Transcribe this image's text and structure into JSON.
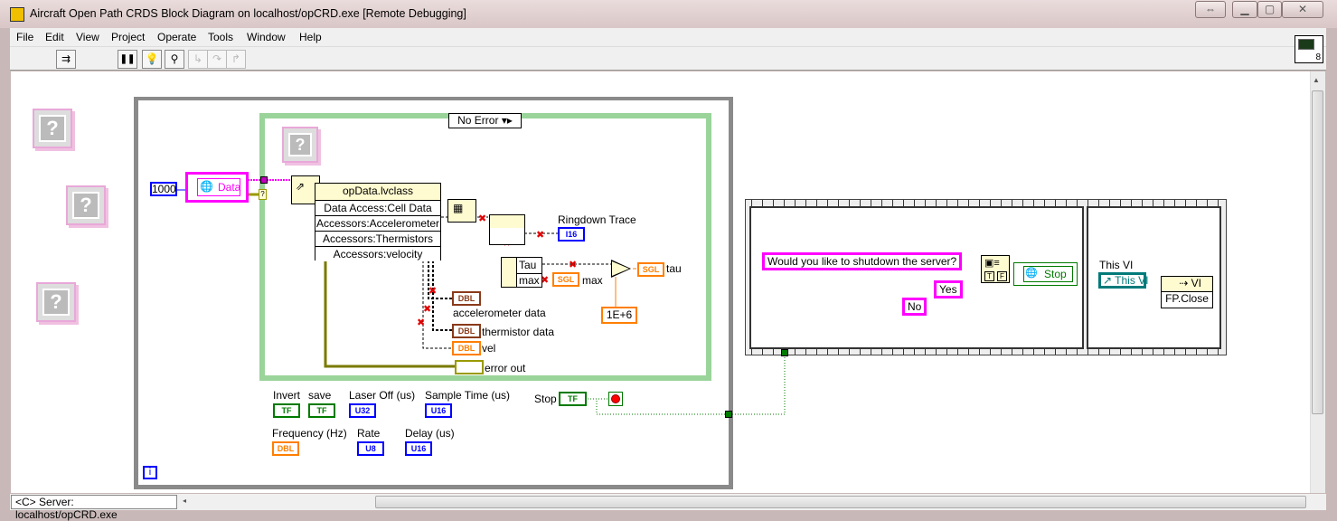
{
  "window": {
    "title": "Aircraft Open Path CRDS Block Diagram on localhost/opCRD.exe [Remote Debugging]",
    "controls": {
      "swap": "⇔",
      "minimize": "▁",
      "maximize": "▢",
      "close": "✕"
    }
  },
  "menu": [
    "File",
    "Edit",
    "View",
    "Project",
    "Operate",
    "Tools",
    "Window",
    "Help"
  ],
  "toolbar": {
    "buttons": [
      {
        "icon": "abort-remote-icon",
        "glyph": "⇉"
      },
      {
        "icon": "pause-icon",
        "glyph": "❚❚"
      },
      {
        "icon": "highlight-execution-bulb-icon",
        "glyph": "💡"
      },
      {
        "icon": "retain-wire-values-icon",
        "glyph": "⚲"
      },
      {
        "icon": "step-into-icon",
        "glyph": "↳"
      },
      {
        "icon": "step-over-icon",
        "glyph": "↷"
      },
      {
        "icon": "step-out-icon",
        "glyph": "↱"
      }
    ],
    "vi_icon_number": "8"
  },
  "diagram": {
    "timeout_const": "1000",
    "network_var": "Data",
    "case_selector": "No Error",
    "unbundle": {
      "class": "opData.lvclass",
      "items": [
        "Data Access:Cell Data",
        "Accessors:Accelerometer",
        "Accessors:Thermistors",
        "Accessors:velocity"
      ]
    },
    "indicators": {
      "ringdown": {
        "label": "Ringdown Trace",
        "type": "I16"
      },
      "tau": {
        "label": "tau",
        "type": "SGL"
      },
      "max": {
        "label": "max",
        "type": "SGL"
      },
      "accel": {
        "label": "accelerometer data",
        "type": "DBL"
      },
      "therm": {
        "label": "thermistor data",
        "type": "DBL"
      },
      "vel": {
        "label": "vel",
        "type": "DBL"
      },
      "error": {
        "label": "error out"
      }
    },
    "unbundle_tau": [
      "Tau",
      "max"
    ],
    "multiplier_const": "1E+6",
    "controls": [
      {
        "label": "Invert",
        "type": "TF"
      },
      {
        "label": "save",
        "type": "TF"
      },
      {
        "label": "Laser Off (us)",
        "type": "U32"
      },
      {
        "label": "Sample Time (us)",
        "type": "U16"
      },
      {
        "label": "Frequency (Hz)",
        "type": "DBL"
      },
      {
        "label": "Rate",
        "type": "U8"
      },
      {
        "label": "Delay (us)",
        "type": "U16"
      }
    ],
    "stop": {
      "label": "Stop",
      "type": "TF"
    },
    "iteration": "i",
    "dialog": {
      "message": "Would you like to shutdown the server?",
      "yes": "Yes",
      "no": "No",
      "t": "T",
      "f": "F"
    },
    "stop_var": "Stop",
    "this_vi": {
      "label": "This VI",
      "ref": "This VI",
      "node": "VI",
      "method": "FP.Close"
    }
  },
  "status": {
    "context": "<C> Server: localhost/opCRD.exe"
  },
  "colors": {
    "string": "#ff00ff",
    "boolean": "#007a00",
    "integer": "#0000ff",
    "float": "#ff7f00",
    "error": "#9a9a00",
    "refnum": "#007a7a"
  }
}
